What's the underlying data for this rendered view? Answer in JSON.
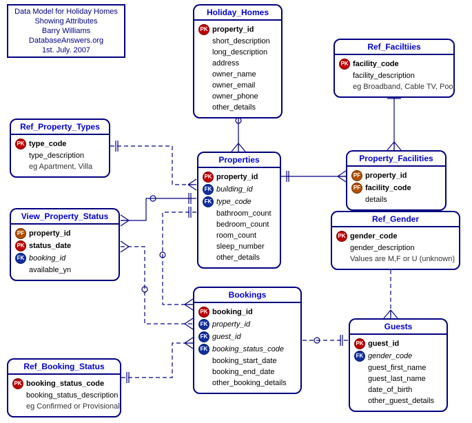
{
  "info": {
    "line1": "Data Model for Holiday Homes",
    "line2": "Showing Attributes",
    "line3": "Barry Williams",
    "line4": "DatabaseAnswers.org",
    "line5": "1st. July. 2007"
  },
  "entities": {
    "holiday_homes": {
      "title": "Holiday_Homes",
      "attrs": [
        {
          "key": "pk",
          "name": "property_id"
        },
        {
          "name": "short_description"
        },
        {
          "name": "long_description"
        },
        {
          "name": "address"
        },
        {
          "name": "owner_name"
        },
        {
          "name": "owner_email"
        },
        {
          "name": "owner_phone"
        },
        {
          "name": "other_details"
        }
      ]
    },
    "ref_facilities": {
      "title": "Ref_Faciltiies",
      "attrs": [
        {
          "key": "pk",
          "name": "facility_code"
        },
        {
          "name": "facility_description"
        },
        {
          "note": true,
          "name": "eg Broadband, Cable TV, Pool"
        }
      ]
    },
    "ref_property_types": {
      "title": "Ref_Property_Types",
      "attrs": [
        {
          "key": "pk",
          "name": "type_code"
        },
        {
          "name": "type_description"
        },
        {
          "note": true,
          "name": "eg Apartment, Villa"
        }
      ]
    },
    "properties": {
      "title": "Properties",
      "attrs": [
        {
          "key": "pk",
          "name": "property_id"
        },
        {
          "key": "fk",
          "italic": true,
          "name": "building_id"
        },
        {
          "key": "fk",
          "italic": true,
          "name": "type_code"
        },
        {
          "name": "bathroom_count"
        },
        {
          "name": "bedroom_count"
        },
        {
          "name": "room_count"
        },
        {
          "name": "sleep_number"
        },
        {
          "name": "other_details"
        }
      ]
    },
    "property_facilities": {
      "title": "Property_Facilities",
      "attrs": [
        {
          "key": "pf",
          "name": "property_id"
        },
        {
          "key": "pf",
          "name": "facility_code"
        },
        {
          "name": "details"
        }
      ]
    },
    "ref_gender": {
      "title": "Ref_Gender",
      "attrs": [
        {
          "key": "pk",
          "name": "gender_code"
        },
        {
          "name": "gender_description"
        },
        {
          "note": true,
          "name": "Values are M,F or U (unknown)"
        }
      ]
    },
    "view_property_status": {
      "title": "View_Property_Status",
      "attrs": [
        {
          "key": "pf",
          "name": "property_id"
        },
        {
          "key": "pk",
          "name": "status_date"
        },
        {
          "key": "fk",
          "italic": true,
          "name": "booking_id"
        },
        {
          "name": "available_yn"
        }
      ]
    },
    "bookings": {
      "title": "Bookings",
      "attrs": [
        {
          "key": "pk",
          "name": "booking_id"
        },
        {
          "key": "fk",
          "italic": true,
          "name": "property_id"
        },
        {
          "key": "fk",
          "italic": true,
          "name": "guest_id"
        },
        {
          "key": "fk",
          "italic": true,
          "name": "booking_status_code"
        },
        {
          "name": "booking_start_date"
        },
        {
          "name": "booking_end_date"
        },
        {
          "name": "other_booking_details"
        }
      ]
    },
    "guests": {
      "title": "Guests",
      "attrs": [
        {
          "key": "pk",
          "name": "guest_id"
        },
        {
          "key": "fk",
          "italic": true,
          "name": "gender_code"
        },
        {
          "name": "guest_first_name"
        },
        {
          "name": "guest_last_name"
        },
        {
          "name": "date_of_birth"
        },
        {
          "name": "other_guest_details"
        }
      ]
    },
    "ref_booking_status": {
      "title": "Ref_Booking_Status",
      "attrs": [
        {
          "key": "pk",
          "name": "booking_status_code"
        },
        {
          "name": "booking_status_description"
        },
        {
          "note": true,
          "name": "eg Confirmed or Provisional"
        }
      ]
    }
  },
  "key_glyphs": {
    "pk": "PK",
    "fk": "FK",
    "pf": "PF"
  }
}
